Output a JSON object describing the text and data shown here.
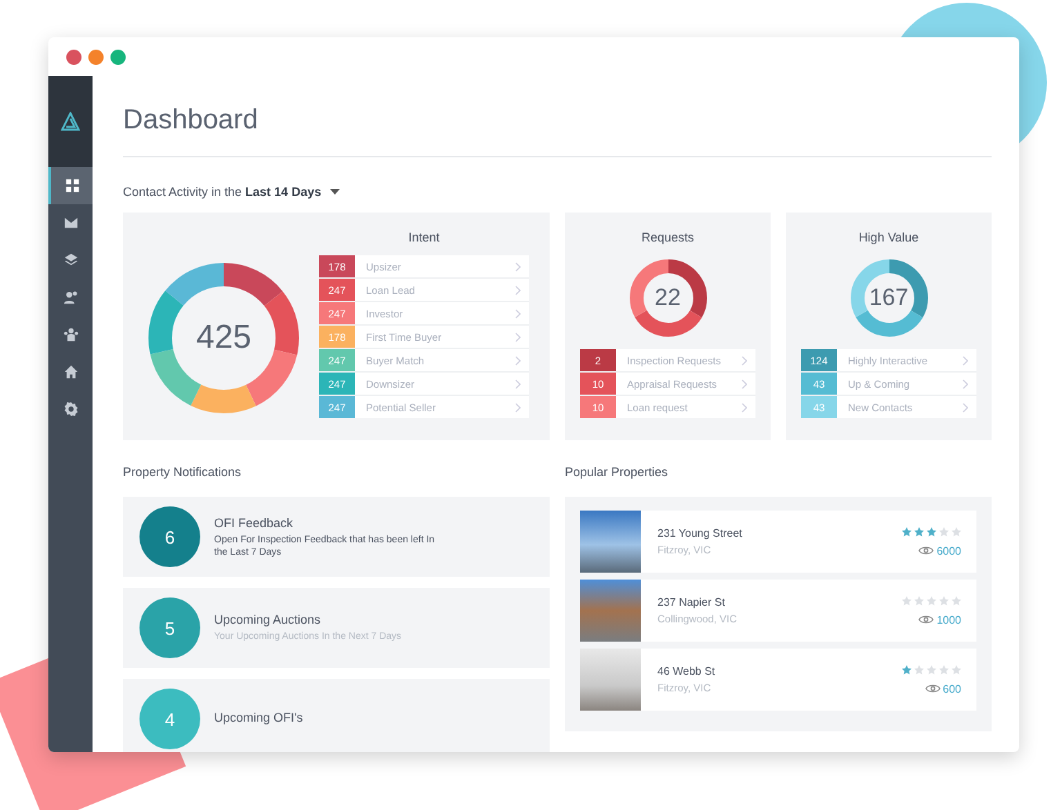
{
  "window": {
    "controls": [
      {
        "color": "#d9525e"
      },
      {
        "color": "#f4822b"
      },
      {
        "color": "#17b57d"
      }
    ]
  },
  "sidebar": {
    "items": [
      {
        "kind": "grid",
        "selected": true
      },
      {
        "kind": "mail",
        "selected": false
      },
      {
        "kind": "layers",
        "selected": false
      },
      {
        "kind": "users",
        "selected": false
      },
      {
        "kind": "group",
        "selected": false
      },
      {
        "kind": "home",
        "selected": false
      },
      {
        "kind": "gear",
        "selected": false
      }
    ]
  },
  "page": {
    "title": "Dashboard",
    "filter": "Contact Activity in the **Last 14 Days**"
  },
  "panels": [
    {
      "title": "Intent",
      "total": "425",
      "kind": "wide",
      "items": [
        {
          "count": "178",
          "label": "Upsizer",
          "color": "#c9485a"
        },
        {
          "count": "247",
          "label": "Loan Lead",
          "color": "#e4535a"
        },
        {
          "count": "247",
          "label": "Investor",
          "color": "#f6787a"
        },
        {
          "count": "178",
          "label": "First Time Buyer",
          "color": "#fbb15f"
        },
        {
          "count": "247",
          "label": "Buyer Match",
          "color": "#62c8ad"
        },
        {
          "count": "247",
          "label": "Downsizer",
          "color": "#2cb5b7"
        },
        {
          "count": "247",
          "label": "Potential Seller",
          "color": "#5ab8d6"
        }
      ]
    },
    {
      "title": "Requests",
      "total": "22",
      "kind": "compact",
      "items": [
        {
          "count": "2",
          "label": "Inspection Requests",
          "color": "#bb3a45"
        },
        {
          "count": "10",
          "label": "Appraisal Requests",
          "color": "#e4535a"
        },
        {
          "count": "10",
          "label": "Loan request",
          "color": "#f6787a"
        }
      ]
    },
    {
      "title": "High Value",
      "total": "167",
      "kind": "compact",
      "items": [
        {
          "count": "124",
          "label": "Highly Interactive",
          "color": "#3d9bb0"
        },
        {
          "count": "43",
          "label": "Up & Coming",
          "color": "#55bcd3"
        },
        {
          "count": "43",
          "label": "New Contacts",
          "color": "#86d6e9"
        }
      ]
    }
  ],
  "notifications": {
    "title": "Property Notifications",
    "items": [
      {
        "count": "6",
        "title": "OFI Feedback",
        "text": "Open For Inspection Feedback that has been left In the Last 7 Days",
        "color": "#14808c",
        "kind": "emphasis"
      },
      {
        "count": "5",
        "title": "Upcoming Auctions",
        "text": "Your Upcoming Auctions In the Next 7 Days",
        "color": "#2aa3a8",
        "kind": "plain"
      },
      {
        "count": "4",
        "title": "Upcoming OFI's",
        "color": "#3cbcbf"
      }
    ]
  },
  "popular": {
    "title": "Popular Properties",
    "items": [
      {
        "name": "231 Young Street",
        "suburb": "Fitzroy, VIC",
        "stars": 3,
        "views": "6000"
      },
      {
        "name": "237 Napier St",
        "suburb": "Collingwood, VIC",
        "stars": 0,
        "views": "1000"
      },
      {
        "name": "46 Webb St",
        "suburb": "Fitzroy, VIC",
        "stars": 1,
        "views": "600"
      }
    ]
  }
}
